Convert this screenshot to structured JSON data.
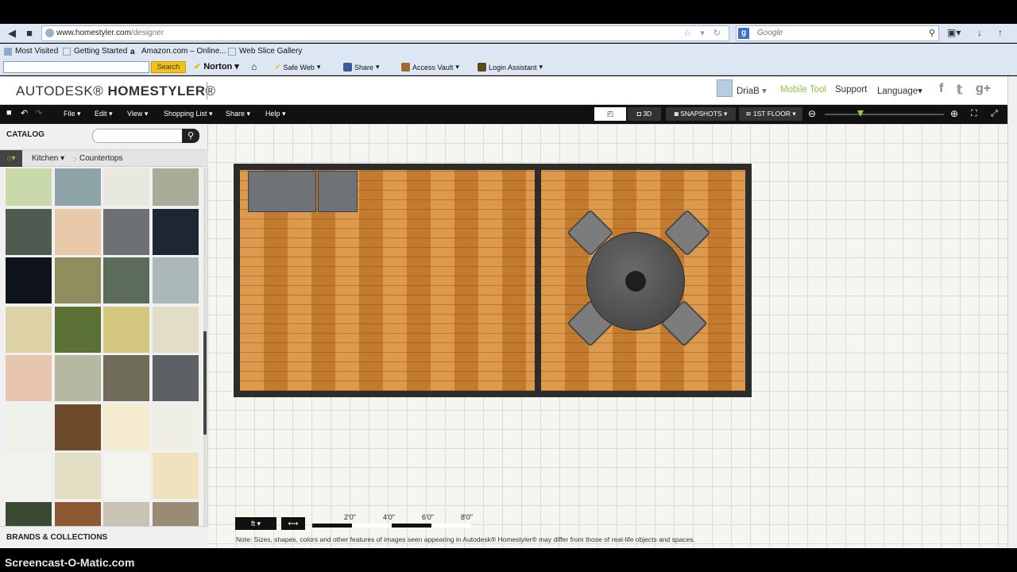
{
  "browser": {
    "url_host": "www.homestyler.com",
    "url_path": "/designer",
    "search_placeholder": "Google",
    "bookmarks": [
      "Most Visited",
      "Getting Started",
      "Amazon.com – Online...",
      "Web Slice Gallery"
    ],
    "toolbar": {
      "search_label": "Search",
      "norton": "Norton",
      "safe_web": "Safe Web",
      "share": "Share",
      "access_vault": "Access Vault",
      "login_assistant": "Login Assistant"
    }
  },
  "header": {
    "logo_light": "AUTODESK",
    "logo_bold": "HOMESTYLER",
    "user": "DriaB",
    "mobile_tool": "Mobile Tool",
    "support": "Support",
    "language": "Language"
  },
  "appbar": {
    "menus": [
      "File",
      "Edit",
      "View",
      "Shopping List",
      "Share",
      "Help"
    ],
    "view_3d": "3D",
    "snapshots": "SNAPSHOTS",
    "floor": "1ST FLOOR",
    "zoom_level": 0.3
  },
  "catalog": {
    "title": "CATALOG",
    "search_placeholder": "",
    "breadcrumb": [
      "Kitchen",
      "Countertops"
    ],
    "brands": "BRANDS & COLLECTIONS",
    "swatch_colors": [
      "#c9d9a9",
      "#8ea3a7",
      "#e9e8de",
      "#a9ad98",
      "#4f5a51",
      "#e8c9aa",
      "#6d7173",
      "#1f2633",
      "#0f141b",
      "#8f8e5e",
      "#5b6b5c",
      "#aab8b9",
      "#dcd2a6",
      "#5b7034",
      "#d4c77f",
      "#e2ddc6",
      "#e8c5ae",
      "#b5b9a2",
      "#6f6c5a",
      "#5b6165",
      "#eef0ea",
      "#6c4a2a",
      "#f5ecd0",
      "#efefe8",
      "#f2f3ee",
      "#e3dfc4",
      "#f4f5ee",
      "#f0e2bd",
      "#3a4a33",
      "#8d5834",
      "#c9c3b4",
      "#9a8c72"
    ]
  },
  "canvas": {
    "unit": "ft",
    "scale_labels": [
      "2'0\"",
      "4'0\"",
      "6'0\"",
      "8'0\""
    ],
    "note": "Note: Sizes, shapes, colors and other features of images seen appearing in Autodesk® Homestyler® may differ from those of real-life objects and spaces."
  },
  "watermark": "Screencast-O-Matic.com",
  "colors": {
    "accent_green": "#8cc63f",
    "appbar_bg": "#111111",
    "mobile_tool": "#8cc63f"
  }
}
